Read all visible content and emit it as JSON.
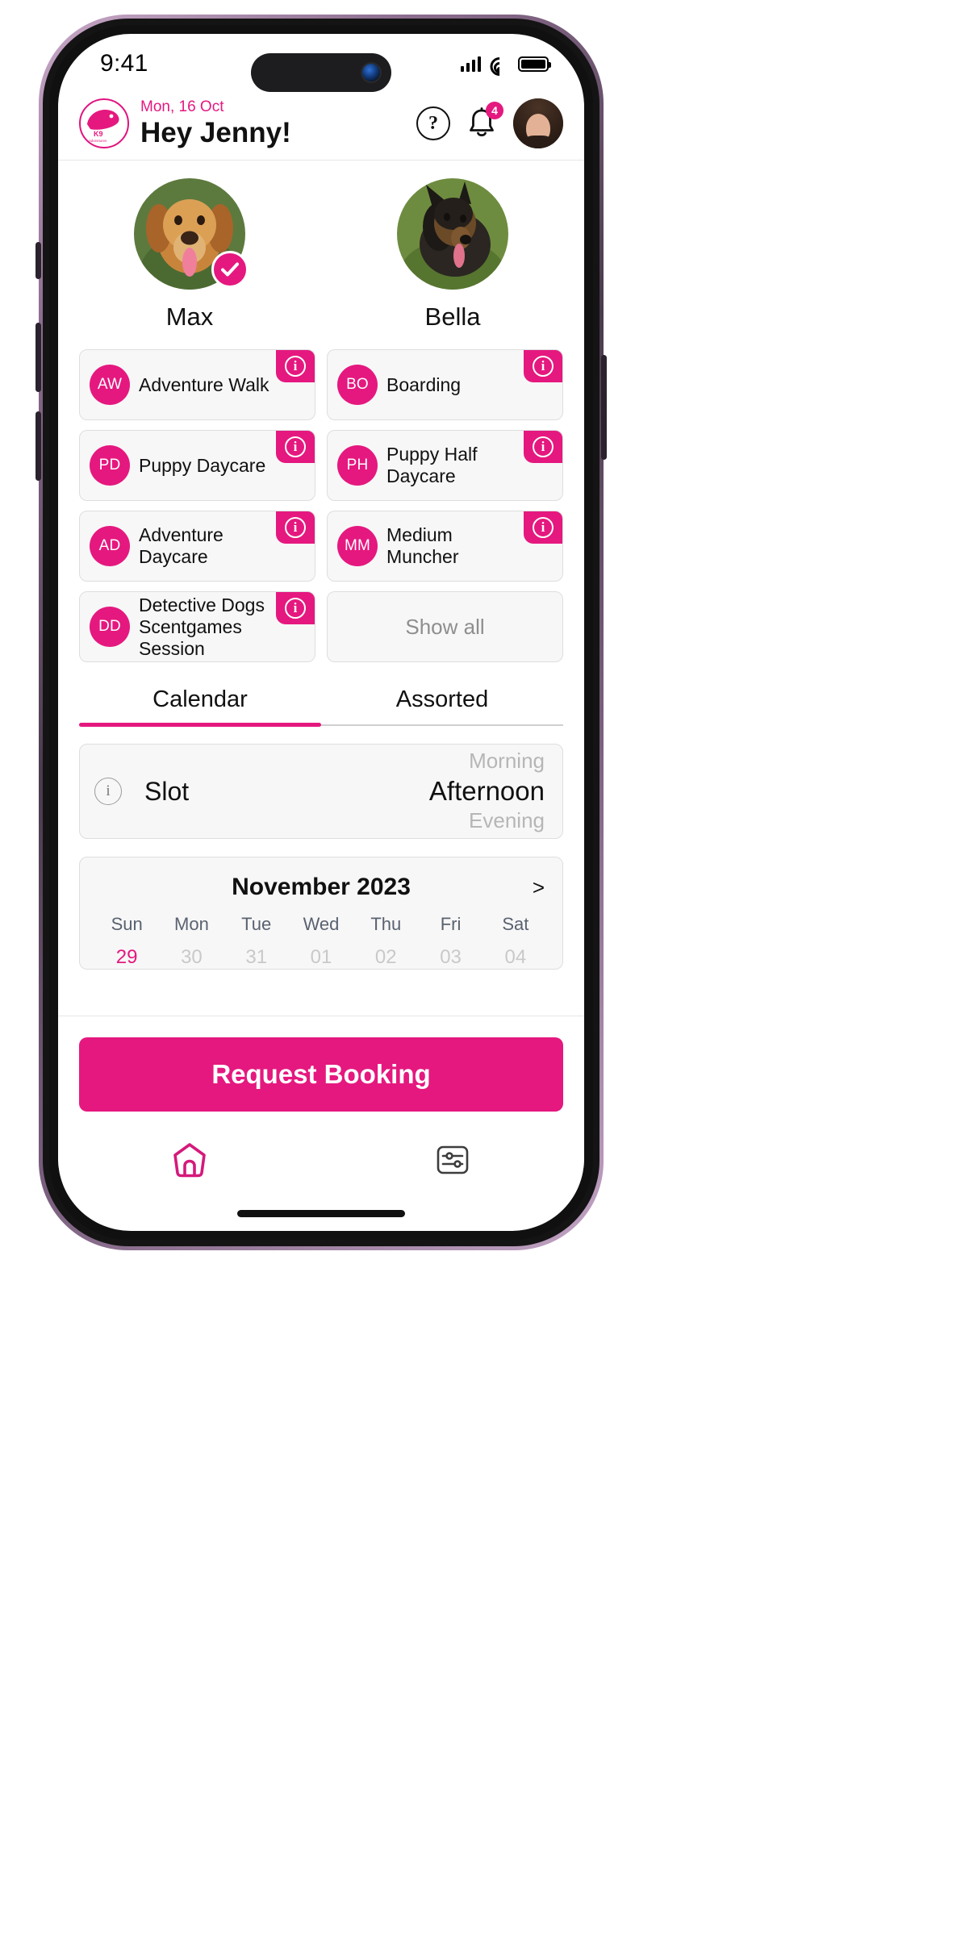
{
  "status_bar": {
    "time": "9:41",
    "signal_icon": "cellular-bars-icon",
    "wifi_icon": "wifi-icon",
    "battery_icon": "battery-icon"
  },
  "header": {
    "logo_icon": "k9-dog-logo",
    "logo_text": "K9",
    "date": "Mon, 16 Oct",
    "greeting": "Hey Jenny!",
    "help_icon": "question-mark-circle-icon",
    "help_label": "?",
    "bell_icon": "bell-icon",
    "notification_count": "4",
    "avatar_icon": "user-avatar"
  },
  "pets": [
    {
      "name": "Max",
      "selected": true,
      "check_icon": "check-circle-icon"
    },
    {
      "name": "Bella",
      "selected": false
    }
  ],
  "services": [
    {
      "initials": "AW",
      "label": "Adventure Walk",
      "info_icon": "info-icon"
    },
    {
      "initials": "BO",
      "label": "Boarding",
      "info_icon": "info-icon"
    },
    {
      "initials": "PD",
      "label": "Puppy Daycare",
      "info_icon": "info-icon"
    },
    {
      "initials": "PH",
      "label": "Puppy Half Daycare",
      "info_icon": "info-icon"
    },
    {
      "initials": "AD",
      "label": "Adventure Daycare",
      "info_icon": "info-icon"
    },
    {
      "initials": "MM",
      "label": "Medium Muncher",
      "info_icon": "info-icon"
    },
    {
      "initials": "DD",
      "label": "Detective Dogs Scentgames Session",
      "info_icon": "info-icon"
    }
  ],
  "show_all_label": "Show all",
  "tabs": [
    {
      "label": "Calendar",
      "active": true
    },
    {
      "label": "Assorted",
      "active": false
    }
  ],
  "slot": {
    "info_icon": "info-icon",
    "label": "Slot",
    "options_above": "Morning",
    "selected": "Afternoon",
    "options_below": "Evening"
  },
  "calendar": {
    "title": "November 2023",
    "next_icon": "chevron-right-icon",
    "next_label": ">",
    "day_names": [
      "Sun",
      "Mon",
      "Tue",
      "Wed",
      "Thu",
      "Fri",
      "Sat"
    ],
    "first_row_days": [
      "29",
      "30",
      "31",
      "01",
      "02",
      "03",
      "04"
    ],
    "selected_day": "29"
  },
  "cta": {
    "label": "Request Booking"
  },
  "bottom_nav": [
    {
      "icon": "home-icon",
      "active": true
    },
    {
      "icon": "sliders-settings-icon",
      "active": false
    }
  ],
  "colors": {
    "accent": "#e5187f",
    "card_bg": "#f7f7f7",
    "card_border": "#dedede",
    "muted_text": "#b6b6b6"
  }
}
